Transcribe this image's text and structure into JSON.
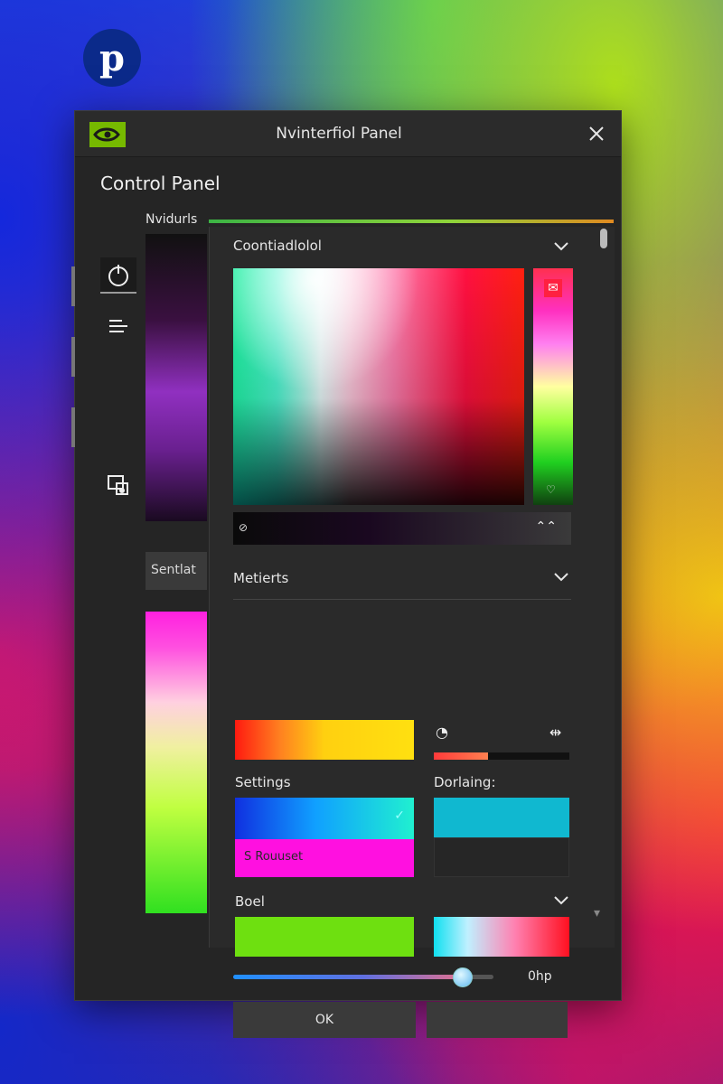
{
  "window": {
    "title": "Nvinterfiol Panel",
    "heading": "Control Panel",
    "nav_label": "Nvidurls"
  },
  "sidebar": {
    "select_label": "Sentlat"
  },
  "sections": {
    "color_picker_label": "Coontiadlolol",
    "meters_label": "Metierts",
    "settings_label": "Settings",
    "dorlaing_label": "Dorlaing:",
    "swatch_text": "S Rouuset",
    "boel_label": "Boel"
  },
  "controls": {
    "slider_value_label": "0hp",
    "slider_value": 0.88,
    "meter_fill": 0.4,
    "ok_label": "OK",
    "second_button_label": ""
  },
  "colors": {
    "nvidia_green": "#76b900",
    "accent_orange": "#ff5a30"
  },
  "icons": {
    "logo": "pinterest-icon",
    "app": "nvidia-icon",
    "close": "close-icon",
    "power": "power-icon",
    "menu": "menu-icon",
    "display": "display-icon"
  }
}
